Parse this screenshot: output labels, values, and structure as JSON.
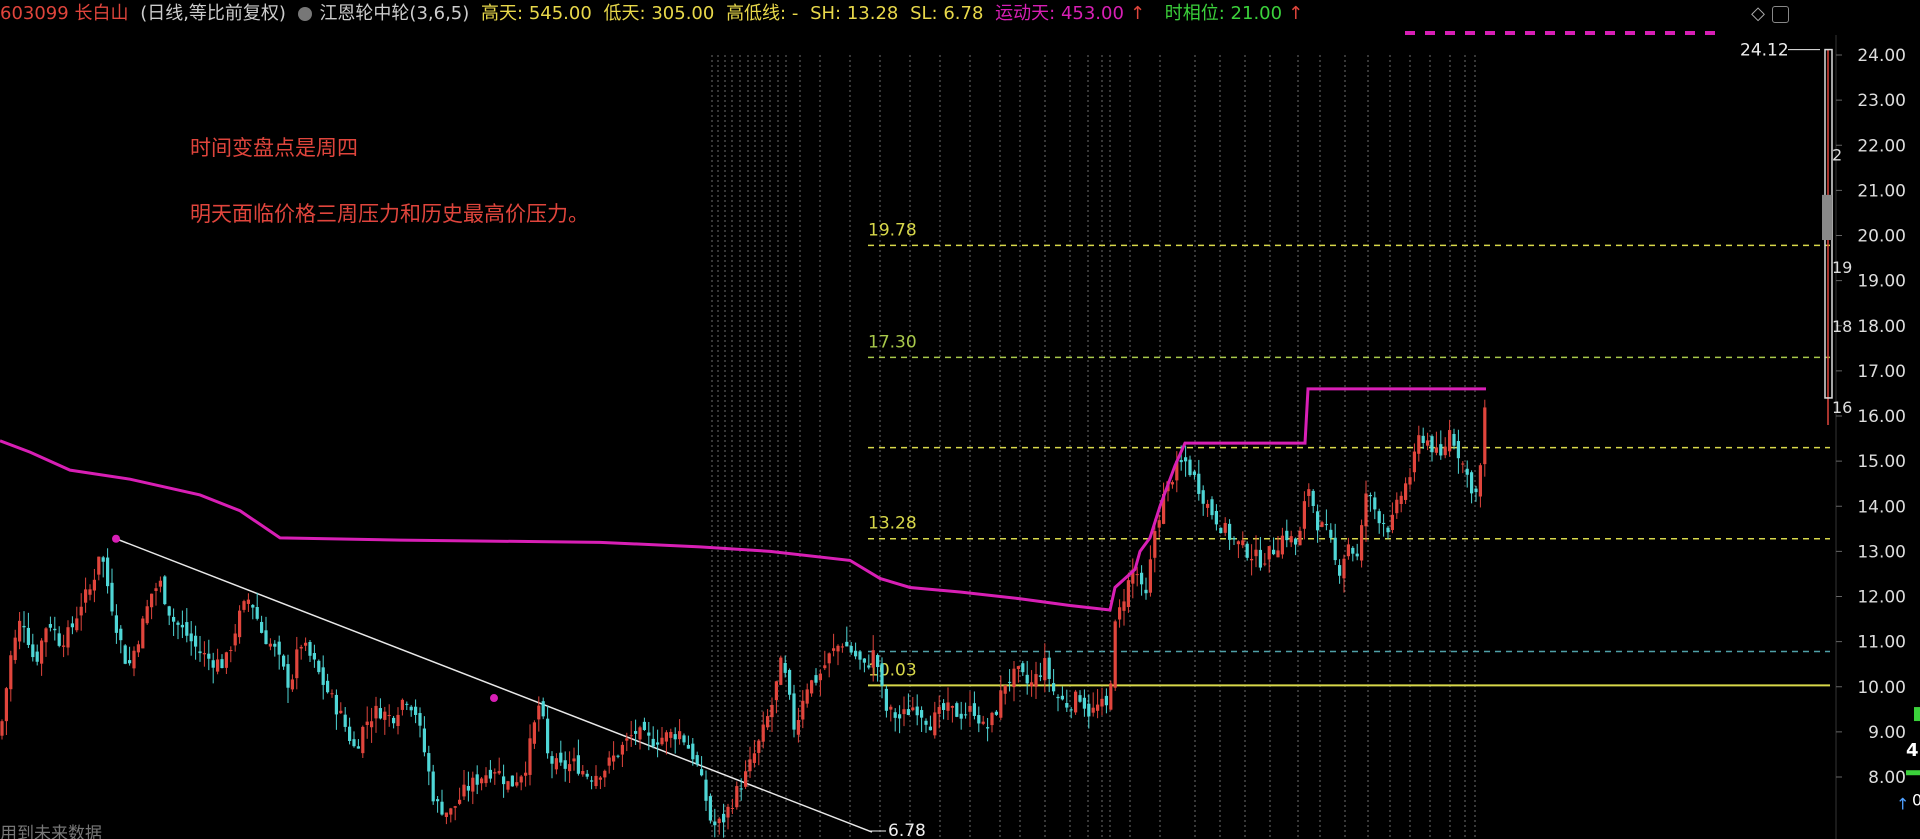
{
  "header": {
    "code": "603099",
    "name": "长白山",
    "mode": "(日线,等比前复权)",
    "indicator": "江恩轮中轮(3,6,5)",
    "high_days": "高天: 545.00",
    "low_days": "低天: 305.00",
    "high_low_line": "高低线: -",
    "sh": "SH: 13.28",
    "sl": "SL: 6.78",
    "move_days": "运动天: 453.00",
    "time_phase": "时相位: 21.00",
    "arrow": "↑"
  },
  "annotations": {
    "line1": "时间变盘点是周四",
    "line2": "明天面临价格三周压力和历史最高价压力。"
  },
  "footer_text": "用到未来数据",
  "right_edge": {
    "top_value": "4",
    "mid_value": "0"
  },
  "colors": {
    "up": "#e0453c",
    "down": "#4fd6d6",
    "ma": "#d81fb5",
    "level": "#d8d84a",
    "grid_v": "#8a8a8a",
    "background": "#000000"
  },
  "chart_data": {
    "type": "candlestick",
    "title": "",
    "y_axis": {
      "min": 7.5,
      "max": 24.4,
      "ticks": [
        "24.00",
        "23.00",
        "22.00",
        "21.00",
        "20.00",
        "19.00",
        "18.00",
        "17.00",
        "16.00",
        "15.00",
        "14.00",
        "13.00",
        "12.00",
        "11.00",
        "10.00",
        "9.00",
        "8.00"
      ]
    },
    "levels": [
      {
        "value": 19.78,
        "label": "19.78",
        "style": "dashed",
        "color": "#d8d84a"
      },
      {
        "value": 17.3,
        "label": "17.30",
        "style": "dashed",
        "color": "#a8c84a"
      },
      {
        "value": 15.3,
        "label": "",
        "style": "dashed",
        "color": "#d8d84a"
      },
      {
        "value": 13.28,
        "label": "13.28",
        "style": "dashed",
        "color": "#d8d84a"
      },
      {
        "value": 10.78,
        "label": "",
        "style": "dashed",
        "color": "#4fa0a8"
      },
      {
        "value": 10.03,
        "label": "10.03",
        "style": "solid",
        "color": "#d8d84a"
      }
    ],
    "price_labels": {
      "high": "24.12",
      "low": "6.78"
    },
    "right_partial_labels": [
      "2",
      "19",
      "18",
      "16"
    ],
    "trendline": {
      "from": 13.28,
      "to": 6.78
    },
    "close_path": [
      [
        0,
        8.9
      ],
      [
        10,
        10.6
      ],
      [
        22,
        11.6
      ],
      [
        35,
        10.5
      ],
      [
        48,
        11.5
      ],
      [
        60,
        11.0
      ],
      [
        70,
        11.2
      ],
      [
        82,
        11.9
      ],
      [
        92,
        12.2
      ],
      [
        100,
        13.1
      ],
      [
        108,
        12.2
      ],
      [
        118,
        11.2
      ],
      [
        128,
        10.4
      ],
      [
        140,
        11.2
      ],
      [
        152,
        12.1
      ],
      [
        160,
        12.3
      ],
      [
        172,
        11.5
      ],
      [
        185,
        11.2
      ],
      [
        198,
        10.8
      ],
      [
        210,
        10.6
      ],
      [
        225,
        10.5
      ],
      [
        240,
        11.6
      ],
      [
        250,
        12.0
      ],
      [
        262,
        11.2
      ],
      [
        275,
        10.8
      ],
      [
        290,
        10.0
      ],
      [
        300,
        11.0
      ],
      [
        312,
        10.6
      ],
      [
        325,
        10.0
      ],
      [
        340,
        9.4
      ],
      [
        355,
        8.6
      ],
      [
        365,
        9.2
      ],
      [
        378,
        9.5
      ],
      [
        392,
        9.3
      ],
      [
        405,
        9.8
      ],
      [
        415,
        9.5
      ],
      [
        425,
        8.5
      ],
      [
        435,
        7.4
      ],
      [
        450,
        7.2
      ],
      [
        465,
        7.7
      ],
      [
        480,
        8.0
      ],
      [
        495,
        8.2
      ],
      [
        510,
        7.8
      ],
      [
        525,
        8.2
      ],
      [
        540,
        9.7
      ],
      [
        548,
        8.4
      ],
      [
        560,
        8.2
      ],
      [
        575,
        8.3
      ],
      [
        590,
        8.0
      ],
      [
        605,
        8.2
      ],
      [
        620,
        8.6
      ],
      [
        635,
        9.0
      ],
      [
        650,
        8.8
      ],
      [
        665,
        8.9
      ],
      [
        680,
        9.0
      ],
      [
        695,
        8.4
      ],
      [
        705,
        7.6
      ],
      [
        712,
        6.9
      ],
      [
        722,
        7.0
      ],
      [
        735,
        7.6
      ],
      [
        745,
        8.0
      ],
      [
        760,
        8.8
      ],
      [
        772,
        9.6
      ],
      [
        782,
        10.6
      ],
      [
        795,
        9.0
      ],
      [
        805,
        10.0
      ],
      [
        818,
        10.2
      ],
      [
        830,
        10.7
      ],
      [
        842,
        11.0
      ],
      [
        855,
        10.7
      ],
      [
        865,
        10.4
      ],
      [
        875,
        10.8
      ],
      [
        885,
        9.5
      ],
      [
        900,
        9.3
      ],
      [
        915,
        9.6
      ],
      [
        930,
        9.2
      ],
      [
        945,
        9.5
      ],
      [
        960,
        9.4
      ],
      [
        975,
        9.5
      ],
      [
        985,
        9.0
      ],
      [
        995,
        9.4
      ],
      [
        1005,
        10.1
      ],
      [
        1018,
        10.3
      ],
      [
        1030,
        10.0
      ],
      [
        1045,
        10.5
      ],
      [
        1055,
        9.8
      ],
      [
        1068,
        9.6
      ],
      [
        1080,
        9.8
      ],
      [
        1090,
        9.4
      ],
      [
        1100,
        9.6
      ],
      [
        1108,
        9.5
      ],
      [
        1115,
        11.3
      ],
      [
        1125,
        12.1
      ],
      [
        1135,
        12.7
      ],
      [
        1145,
        11.8
      ],
      [
        1155,
        13.5
      ],
      [
        1165,
        14.3
      ],
      [
        1175,
        14.8
      ],
      [
        1185,
        15.0
      ],
      [
        1195,
        14.6
      ],
      [
        1208,
        14.0
      ],
      [
        1220,
        13.6
      ],
      [
        1235,
        13.2
      ],
      [
        1248,
        13.0
      ],
      [
        1260,
        12.8
      ],
      [
        1272,
        13.0
      ],
      [
        1285,
        13.4
      ],
      [
        1298,
        13.1
      ],
      [
        1308,
        14.5
      ],
      [
        1318,
        13.6
      ],
      [
        1328,
        13.4
      ],
      [
        1338,
        12.5
      ],
      [
        1348,
        13.2
      ],
      [
        1358,
        12.8
      ],
      [
        1366,
        14.3
      ],
      [
        1378,
        13.8
      ],
      [
        1390,
        13.5
      ],
      [
        1400,
        14.2
      ],
      [
        1412,
        14.8
      ],
      [
        1420,
        15.6
      ],
      [
        1430,
        15.4
      ],
      [
        1440,
        15.0
      ],
      [
        1450,
        15.7
      ],
      [
        1460,
        15.1
      ],
      [
        1470,
        14.5
      ],
      [
        1478,
        14.2
      ],
      [
        1486,
        16.4
      ],
      [
        1492,
        24.12
      ]
    ],
    "ma_path": [
      [
        0,
        15.45
      ],
      [
        30,
        15.2
      ],
      [
        70,
        14.8
      ],
      [
        130,
        14.6
      ],
      [
        200,
        14.25
      ],
      [
        240,
        13.9
      ],
      [
        260,
        13.6
      ],
      [
        280,
        13.3
      ],
      [
        400,
        13.25
      ],
      [
        600,
        13.2
      ],
      [
        700,
        13.1
      ],
      [
        770,
        13.0
      ],
      [
        850,
        12.8
      ],
      [
        880,
        12.4
      ],
      [
        910,
        12.2
      ],
      [
        960,
        12.1
      ],
      [
        1020,
        11.95
      ],
      [
        1070,
        11.8
      ],
      [
        1110,
        11.7
      ],
      [
        1115,
        12.2
      ],
      [
        1135,
        12.6
      ],
      [
        1140,
        13.0
      ],
      [
        1150,
        13.3
      ],
      [
        1160,
        14.0
      ],
      [
        1175,
        14.9
      ],
      [
        1185,
        15.4
      ],
      [
        1305,
        15.4
      ],
      [
        1308,
        16.6
      ],
      [
        1420,
        16.6
      ],
      [
        1486,
        16.6
      ]
    ],
    "v_lines": [
      712,
      718,
      725,
      732,
      740,
      748,
      755,
      762,
      770,
      778,
      786,
      800,
      820,
      850,
      880,
      910,
      940,
      970,
      1000,
      1020,
      1045,
      1070,
      1088,
      1102,
      1110,
      1130,
      1160,
      1195,
      1220,
      1245,
      1270,
      1298,
      1320,
      1345,
      1368,
      1390,
      1410,
      1430,
      1450,
      1465,
      1475
    ]
  }
}
